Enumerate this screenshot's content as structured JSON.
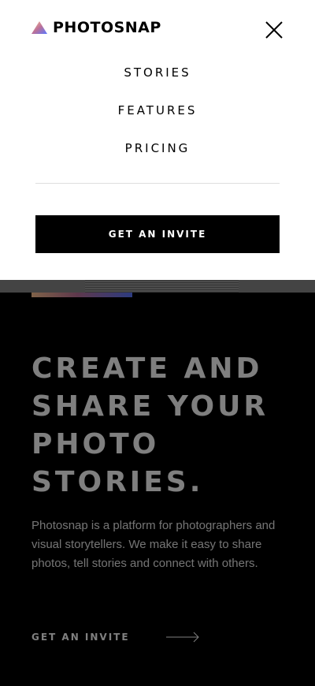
{
  "brand": {
    "name": "PHOTOSNAP",
    "logo_icon": "triangle-gradient-icon"
  },
  "menu": {
    "close_icon": "close-icon",
    "items": [
      {
        "label": "STORIES"
      },
      {
        "label": "FEATURES"
      },
      {
        "label": "PRICING"
      }
    ],
    "cta_label": "GET AN INVITE"
  },
  "hero": {
    "title": "CREATE AND SHARE YOUR PHOTO STORIES.",
    "body": "Photosnap is a platform for photographers and visual storytellers. We make it easy to share photos, tell stories and connect with others.",
    "cta_label": "GET AN INVITE",
    "cta_icon": "arrow-right-icon"
  },
  "colors": {
    "menu_bg": "#ffffff",
    "hero_bg": "#000000",
    "button_bg": "#000000",
    "accent_gradient": [
      "#ffc593",
      "#bc7198",
      "#5a77ff"
    ],
    "overlay": "rgba(0,0,0,0.5)"
  }
}
